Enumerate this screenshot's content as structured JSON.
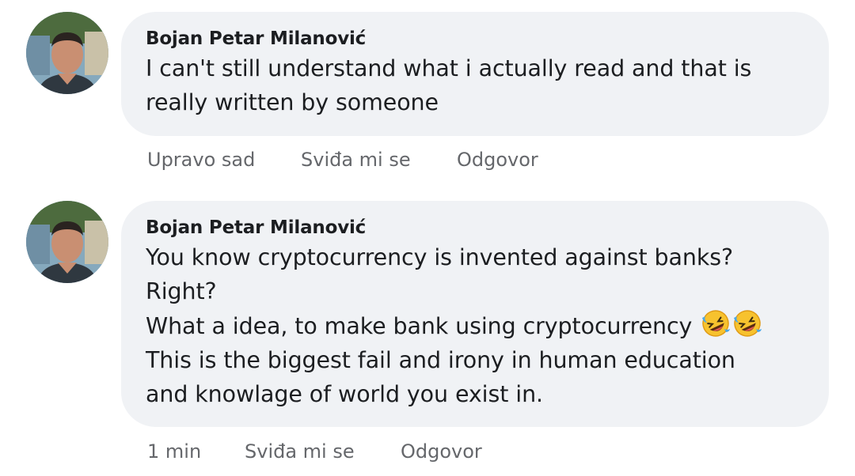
{
  "comments": [
    {
      "author": "Bojan Petar Milanović",
      "lines": [
        "I can't still understand what i actually read and that is",
        "really written by someone"
      ],
      "time": "Upravo sad",
      "like": "Sviđa mi se",
      "reply": "Odgovor"
    },
    {
      "author": "Bojan Petar Milanović",
      "lines": [
        "You know cryptocurrency is invented against banks?",
        "Right?",
        "What a idea, to make bank using cryptocurrency",
        "This is the biggest fail and irony in human education",
        "and knowlage of world you exist in."
      ],
      "emoji": "rolling-on-floor-laughing-emoji",
      "time": "1 min",
      "like": "Sviđa mi se",
      "reply": "Odgovor"
    }
  ]
}
